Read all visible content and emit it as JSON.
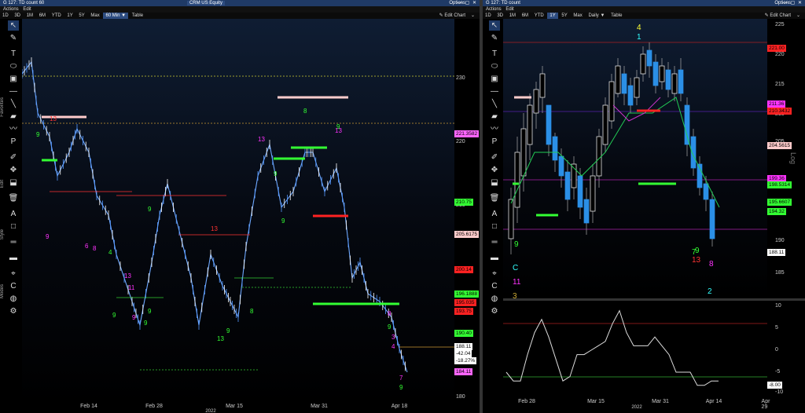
{
  "left": {
    "title": "G 127: TD count 60",
    "security": "CRM US Equity",
    "options": "Options",
    "menus": [
      "Actions",
      "Edit"
    ],
    "periods": [
      "1D",
      "3D",
      "1M",
      "6M",
      "YTD",
      "1Y",
      "5Y",
      "Max",
      "60 Min ▼",
      "Table"
    ],
    "edit_chart": "Edit Chart",
    "side_labels": [
      "Favorites",
      "Edit",
      "Style",
      "Modes"
    ],
    "yticks": [
      "230",
      "220",
      "210",
      "190",
      "180"
    ],
    "xticks": [
      "Feb 14",
      "Feb 28",
      "Mar 15",
      "Mar 31",
      "Apr 18"
    ],
    "x_year": "2022",
    "tags": [
      {
        "text": "221.3582",
        "bg": "#ff66ff"
      },
      {
        "text": "210.75",
        "bg": "#33ff33"
      },
      {
        "text": "205.6175",
        "bg": "#ffcccc"
      },
      {
        "text": "200.14",
        "bg": "#ff2222"
      },
      {
        "text": "196.1888",
        "bg": "#33ff33"
      },
      {
        "text": "195.035",
        "bg": "#ff2222"
      },
      {
        "text": "193.75",
        "bg": "#ff2222"
      },
      {
        "text": "190.40",
        "bg": "#33ff33"
      },
      {
        "text": "188.11",
        "bg": "#ffffff"
      },
      {
        "text": "-42.04",
        "bg": "#ffffff"
      },
      {
        "text": "-18.27%",
        "bg": "#ffffff"
      },
      {
        "text": "184.11",
        "bg": "#ff66ff"
      }
    ],
    "seq": [
      "9",
      "13",
      "9",
      "13",
      "9",
      "9",
      "13",
      "13",
      "9",
      "8",
      "13",
      "9",
      "9",
      "13",
      "11",
      "8",
      "9",
      "8",
      "9",
      "9",
      "4",
      "3",
      "7",
      "9",
      "6",
      "8",
      "9",
      "4",
      "9"
    ]
  },
  "right": {
    "title": "G 127: TD count",
    "options": "Options",
    "menus": [
      "Actions",
      "Edit"
    ],
    "periods": [
      "1D",
      "3D",
      "1M",
      "6M",
      "YTD",
      "1Y",
      "5Y",
      "Max",
      "Daily ▼",
      "Table"
    ],
    "edit_chart": "Edit Chart",
    "yticks": [
      "225",
      "220",
      "215",
      "210",
      "205",
      "190",
      "185"
    ],
    "tags": [
      {
        "text": "221.00",
        "bg": "#ff2222"
      },
      {
        "text": "211.36",
        "bg": "#ff33ff"
      },
      {
        "text": "210.3432",
        "bg": "#ff2222"
      },
      {
        "text": "204.5615",
        "bg": "#ffcccc"
      },
      {
        "text": "199.36",
        "bg": "#ff33ff"
      },
      {
        "text": "198.5314",
        "bg": "#33ff33"
      },
      {
        "text": "195.6607",
        "bg": "#33ff33"
      },
      {
        "text": "194.32",
        "bg": "#33ff33"
      },
      {
        "text": "188.11",
        "bg": "#ffffff"
      }
    ],
    "log_label": "Log",
    "osc_yticks": [
      "10",
      "5",
      "0",
      "-5",
      "-10"
    ],
    "osc_tag": "-8.00",
    "xticks": [
      "Feb 28",
      "Mar 15",
      "Mar 31",
      "Apr 14",
      "Apr 29"
    ],
    "x_year": "2022",
    "seq": [
      "4",
      "1",
      "9",
      "C",
      "3",
      "11",
      "13",
      "9",
      "7",
      "2",
      "8"
    ]
  },
  "colors": {
    "titlebar": "#1f3a66",
    "up_candle": "#ffffff",
    "down_candle": "#2b8fe6",
    "price_line": "#6ea8ff"
  }
}
